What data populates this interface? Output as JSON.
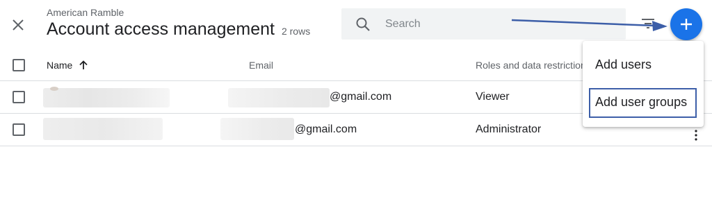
{
  "header": {
    "account_name": "American Ramble",
    "title": "Account access management",
    "row_count": "2 rows"
  },
  "search": {
    "placeholder": "Search"
  },
  "icons": {
    "close": "close-icon",
    "search": "search-icon",
    "filter": "filter-icon",
    "add": "plus-icon",
    "sort": "arrow-up-icon",
    "more": "more-vert-icon"
  },
  "colors": {
    "accent": "#1a73e8",
    "annotation": "#3c5ea8",
    "divider": "#dadce0"
  },
  "table": {
    "columns": [
      "Name",
      "Email",
      "Roles and data restrictions"
    ],
    "sort": "ascending",
    "rows": [
      {
        "email": "@gmail.com",
        "role": "Viewer"
      },
      {
        "email": "@gmail.com",
        "role": "Administrator"
      }
    ]
  },
  "menu": {
    "items": [
      "Add users",
      "Add user groups"
    ],
    "highlighted_index": 1
  }
}
